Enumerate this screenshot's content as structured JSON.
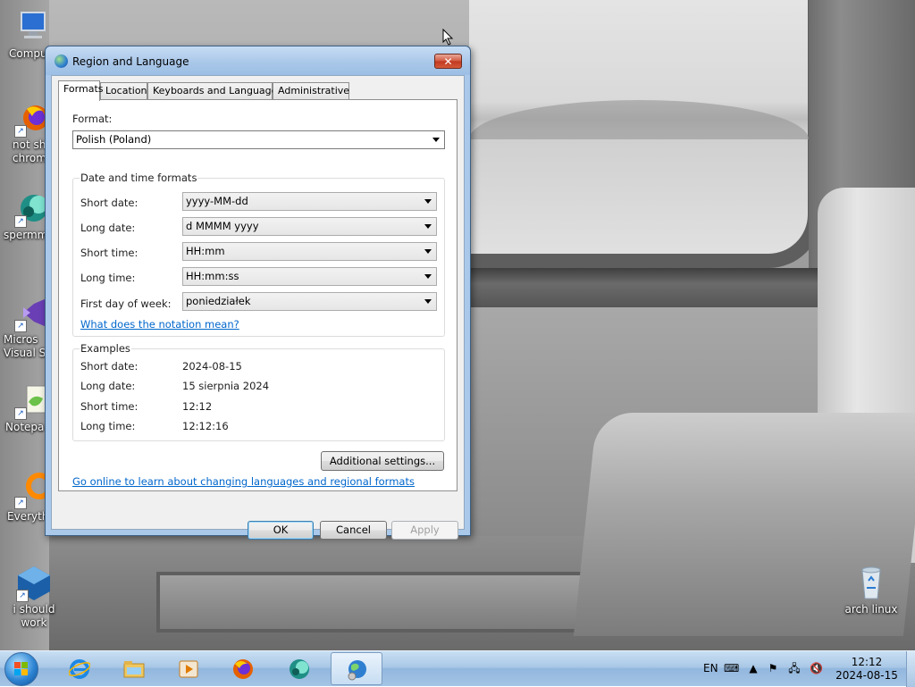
{
  "desktop": {
    "icons": [
      {
        "label": "Compu",
        "icon": "computer-icon"
      },
      {
        "label": "not sh\nchrom",
        "icon": "firefox-icon"
      },
      {
        "label": "spermm",
        "icon": "app-icon"
      },
      {
        "label": "Micros\nVisual St",
        "icon": "visual-studio-icon"
      },
      {
        "label": "Notepa",
        "icon": "notepad-icon"
      },
      {
        "label": "Everyth",
        "icon": "everything-search-icon"
      },
      {
        "label": "i should work",
        "icon": "virtualbox-icon"
      },
      {
        "label": "arch linux",
        "icon": "recycle-bin-icon"
      }
    ]
  },
  "dialog": {
    "title": "Region and Language",
    "close_label": "✕",
    "tabs": [
      {
        "label": "Formats",
        "active": true
      },
      {
        "label": "Location",
        "active": false
      },
      {
        "label": "Keyboards and Languages",
        "active": false
      },
      {
        "label": "Administrative",
        "active": false
      }
    ],
    "format_label": "Format:",
    "format_value": "Polish (Poland)",
    "datetime_group_title": "Date and time formats",
    "datetime_rows": [
      {
        "label": "Short date:",
        "value": "yyyy-MM-dd"
      },
      {
        "label": "Long date:",
        "value": "d MMMM yyyy"
      },
      {
        "label": "Short time:",
        "value": "HH:mm"
      },
      {
        "label": "Long time:",
        "value": "HH:mm:ss"
      },
      {
        "label": "First day of week:",
        "value": "poniedziałek"
      }
    ],
    "notation_link": "What does the notation mean?",
    "examples_group_title": "Examples",
    "examples": [
      {
        "label": "Short date:",
        "value": "2024-08-15"
      },
      {
        "label": "Long date:",
        "value": "15 sierpnia 2024"
      },
      {
        "label": "Short time:",
        "value": "12:12"
      },
      {
        "label": "Long time:",
        "value": "12:12:16"
      }
    ],
    "additional_settings_label": "Additional settings...",
    "online_link": "Go online to learn about changing languages and regional formats",
    "ok_label": "OK",
    "cancel_label": "Cancel",
    "apply_label": "Apply"
  },
  "taskbar": {
    "pinned": [
      "internet-explorer-icon",
      "file-explorer-icon",
      "media-player-icon",
      "firefox-icon",
      "app-icon",
      "region-language-icon"
    ],
    "language": "EN",
    "clock_time": "12:12",
    "clock_date": "2024-08-15"
  }
}
